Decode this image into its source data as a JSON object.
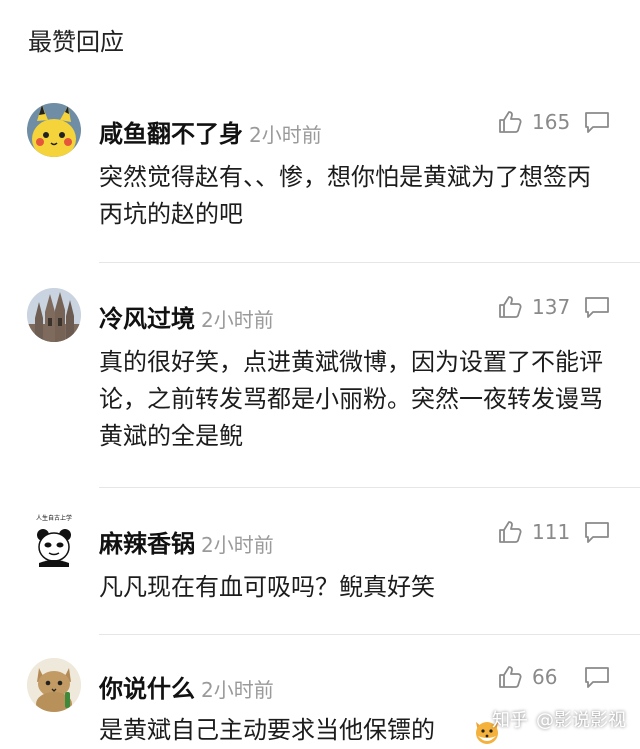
{
  "section": {
    "title": "最赞回应"
  },
  "comments": [
    {
      "username": "咸鱼翻不了身",
      "time": "2小时前",
      "likes": "165",
      "text": "突然觉得赵有、、惨，想你怕是黄斌为了想签丙丙坑的赵的吧",
      "avatar_icon": "pikachu-avatar-icon"
    },
    {
      "username": "冷风过境",
      "time": "2小时前",
      "likes": "137",
      "text": "真的很好笑，点进黄斌微博，因为设置了不能评论，之前转发骂都是小丽粉。突然一夜转发谩骂黄斌的全是鲵",
      "avatar_icon": "cathedral-avatar-icon"
    },
    {
      "username": "麻辣香锅",
      "time": "2小时前",
      "likes": "111",
      "text": "凡凡现在有血可吸吗？鲵真好笑",
      "avatar_icon": "panda-meme-avatar-icon",
      "avatar_caption": "人生自古上学"
    },
    {
      "username": "你说什么",
      "time": "2小时前",
      "likes": "66",
      "text": "是黄斌自己主动要求当他保镖的",
      "avatar_icon": "cat-avatar-icon"
    }
  ],
  "watermark": {
    "platform": "知乎",
    "author": "@影说影视"
  },
  "icons": {
    "like": "thumbs-up-icon",
    "reply": "speech-bubble-icon",
    "emoji": "fox-emoji-icon"
  },
  "colors": {
    "text": "#1c1c1c",
    "muted": "#9a9a9a",
    "icon": "#8a8a8a",
    "divider": "#e6e6e6"
  }
}
